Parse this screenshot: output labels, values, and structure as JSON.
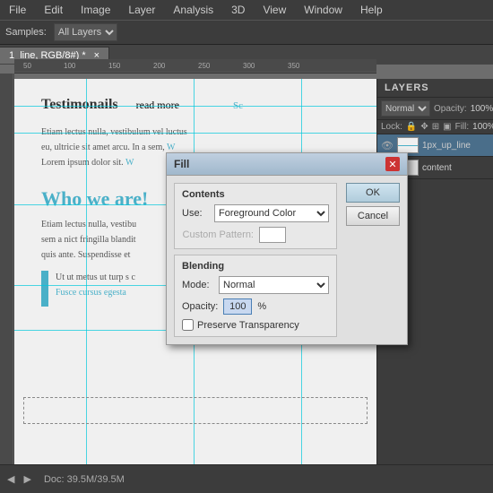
{
  "menubar": {
    "items": [
      "File",
      "Edit",
      "Image",
      "Layer",
      "Analysis",
      "3D",
      "View",
      "Window",
      "Help"
    ]
  },
  "optionsbar": {
    "samples_label": "Samples:",
    "samples_value": "All Layers"
  },
  "tab": {
    "label": "1_line, RGB/8#) *",
    "close": "×"
  },
  "page": {
    "heading1": "Testimonails",
    "read_more": "read more",
    "para1": "Etiam lectus nulla, vestibulum vel luctus",
    "para2": "eu, ultricie sit amet arcu. In a sem,",
    "para3": "Lorem ipsum dolor sit.",
    "heading2": "Who we are!",
    "para4": "Etiam lectus nulla, vestibu",
    "para5": "sem a nict fringilla blandit",
    "para6": "quis ante. Suspendisse et",
    "para7": "Ut ut metus ut turp s c",
    "para8": "Fusce cursus egesta"
  },
  "layers_panel": {
    "title": "LAYERS",
    "mode": "Normal",
    "opacity_label": "Opacity:",
    "opacity_value": "100%",
    "lock_label": "Lock:",
    "fill_label": "Fill:",
    "fill_value": "100%",
    "layers": [
      {
        "name": "1px_up_line",
        "type": "line",
        "visible": true,
        "selected": true
      },
      {
        "name": "content",
        "type": "content",
        "visible": true,
        "selected": false
      }
    ]
  },
  "dialog": {
    "title": "Fill",
    "contents_label": "Contents",
    "use_label": "Use:",
    "use_value": "Foreground Color",
    "custom_pattern_label": "Custom Pattern:",
    "blending_label": "Blending",
    "mode_label": "Mode:",
    "mode_value": "Normal",
    "opacity_label": "Opacity:",
    "opacity_value": "100",
    "opacity_unit": "%",
    "preserve_label": "Preserve Transparency",
    "ok_label": "OK",
    "cancel_label": "Cancel"
  },
  "status": {
    "info": "Doc: 39.5M/39.5M"
  }
}
